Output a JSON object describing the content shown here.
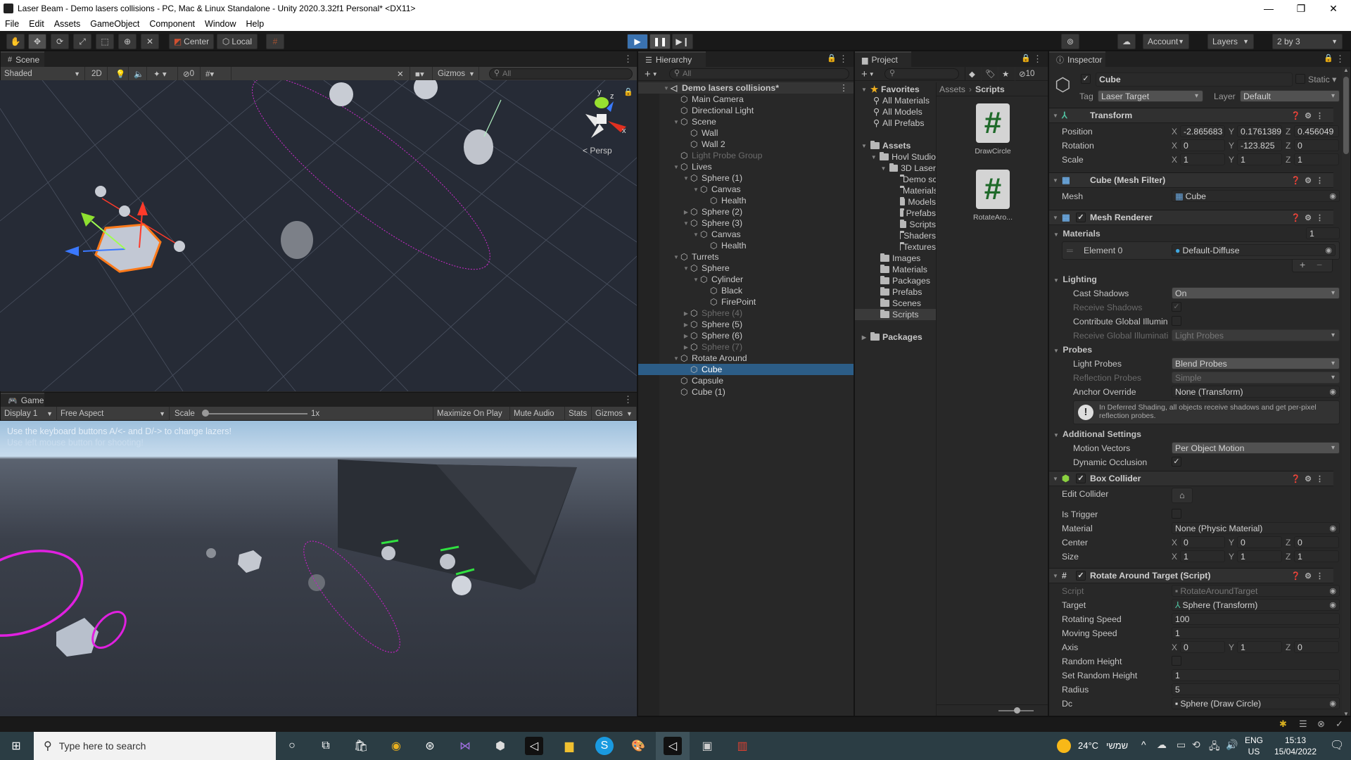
{
  "window": {
    "title": "Laser Beam - Demo lasers collisions - PC, Mac & Linux Standalone - Unity 2020.3.32f1 Personal* <DX11>",
    "controls": {
      "minimize": "—",
      "maximize": "❐",
      "close": "✕"
    }
  },
  "menu": [
    "File",
    "Edit",
    "Assets",
    "GameObject",
    "Component",
    "Window",
    "Help"
  ],
  "toolbar": {
    "tools": [
      "hand-tool",
      "move-tool",
      "rotate-tool",
      "scale-tool",
      "rect-tool",
      "transform-tool",
      "custom-tool"
    ],
    "pivot_label": "Center",
    "space_label": "Local",
    "play_state": "playing",
    "account_label": "Account",
    "layers_label": "Layers",
    "layout_label": "2 by 3"
  },
  "scene": {
    "tab_label": "Scene",
    "shading_mode": "Shaded",
    "mode_2d": "2D",
    "hidden_count": "0",
    "gizmos_label": "Gizmos",
    "search_placeholder": "All",
    "projection_label": "< Persp",
    "axis_labels": {
      "x": "x",
      "y": "y",
      "z": "z"
    }
  },
  "game": {
    "tab_label": "Game",
    "display": "Display 1",
    "aspect": "Free Aspect",
    "scale_label": "Scale",
    "scale_value": "1x",
    "maximize_on_play": "Maximize On Play",
    "mute_audio": "Mute Audio",
    "stats": "Stats",
    "gizmos": "Gizmos",
    "overlay_line1": "Use the keyboard buttons A/<- and D/-> to change lazers!",
    "overlay_line2": "Use left mouse button for shooting!"
  },
  "hierarchy": {
    "tab_label": "Hierarchy",
    "search_placeholder": "All",
    "scene_name": "Demo lasers collisions*",
    "items": [
      {
        "label": "Main Camera",
        "depth": 1,
        "arrow": "",
        "dim": false
      },
      {
        "label": "Directional Light",
        "depth": 1,
        "arrow": "",
        "dim": false
      },
      {
        "label": "Scene",
        "depth": 1,
        "arrow": "▼",
        "dim": false
      },
      {
        "label": "Wall",
        "depth": 2,
        "arrow": "",
        "dim": false
      },
      {
        "label": "Wall 2",
        "depth": 2,
        "arrow": "",
        "dim": false
      },
      {
        "label": "Light Probe Group",
        "depth": 1,
        "arrow": "",
        "dim": true
      },
      {
        "label": "Lives",
        "depth": 1,
        "arrow": "▼",
        "dim": false
      },
      {
        "label": "Sphere (1)",
        "depth": 2,
        "arrow": "▼",
        "dim": false
      },
      {
        "label": "Canvas",
        "depth": 3,
        "arrow": "▼",
        "dim": false
      },
      {
        "label": "Health",
        "depth": 4,
        "arrow": "",
        "dim": false
      },
      {
        "label": "Sphere (2)",
        "depth": 2,
        "arrow": "▶",
        "dim": false
      },
      {
        "label": "Sphere (3)",
        "depth": 2,
        "arrow": "▼",
        "dim": false
      },
      {
        "label": "Canvas",
        "depth": 3,
        "arrow": "▼",
        "dim": false
      },
      {
        "label": "Health",
        "depth": 4,
        "arrow": "",
        "dim": false
      },
      {
        "label": "Turrets",
        "depth": 1,
        "arrow": "▼",
        "dim": false
      },
      {
        "label": "Sphere",
        "depth": 2,
        "arrow": "▼",
        "dim": false
      },
      {
        "label": "Cylinder",
        "depth": 3,
        "arrow": "▼",
        "dim": false
      },
      {
        "label": "Black",
        "depth": 4,
        "arrow": "",
        "dim": false
      },
      {
        "label": "FirePoint",
        "depth": 4,
        "arrow": "",
        "dim": false
      },
      {
        "label": "Sphere (4)",
        "depth": 2,
        "arrow": "▶",
        "dim": true
      },
      {
        "label": "Sphere (5)",
        "depth": 2,
        "arrow": "▶",
        "dim": false
      },
      {
        "label": "Sphere (6)",
        "depth": 2,
        "arrow": "▶",
        "dim": false
      },
      {
        "label": "Sphere (7)",
        "depth": 2,
        "arrow": "▶",
        "dim": true
      },
      {
        "label": "Rotate Around",
        "depth": 1,
        "arrow": "▼",
        "dim": false
      },
      {
        "label": "Cube",
        "depth": 2,
        "arrow": "",
        "dim": false,
        "selected": true
      },
      {
        "label": "Capsule",
        "depth": 1,
        "arrow": "",
        "dim": false
      },
      {
        "label": "Cube (1)",
        "depth": 1,
        "arrow": "",
        "dim": false
      }
    ]
  },
  "project": {
    "tab_label": "Project",
    "hidden_packages_count": "10",
    "breadcrumb": [
      "Assets",
      "Scripts"
    ],
    "favorites_label": "Favorites",
    "favorites": [
      "All Materials",
      "All Models",
      "All Prefabs"
    ],
    "assets_label": "Assets",
    "tree": [
      {
        "label": "Hovl Studio",
        "depth": 1,
        "open": true
      },
      {
        "label": "3D Laser",
        "depth": 2,
        "open": true
      },
      {
        "label": "Demo scenes",
        "depth": 3
      },
      {
        "label": "Materials",
        "depth": 3
      },
      {
        "label": "Models",
        "depth": 3
      },
      {
        "label": "Prefabs",
        "depth": 3
      },
      {
        "label": "Scripts",
        "depth": 3
      },
      {
        "label": "Shaders",
        "depth": 3
      },
      {
        "label": "Textures",
        "depth": 3
      },
      {
        "label": "Images",
        "depth": 1
      },
      {
        "label": "Materials",
        "depth": 1
      },
      {
        "label": "Packages",
        "depth": 1
      },
      {
        "label": "Prefabs",
        "depth": 1
      },
      {
        "label": "Scenes",
        "depth": 1
      },
      {
        "label": "Scripts",
        "depth": 1,
        "selected": true
      }
    ],
    "packages_label": "Packages",
    "files": [
      {
        "name": "DrawCircle",
        "icon": "csharp-script-icon"
      },
      {
        "name": "RotateAro...",
        "icon": "csharp-script-icon"
      }
    ]
  },
  "inspector": {
    "tab_label": "Inspector",
    "object_name": "Cube",
    "active": true,
    "static_label": "Static",
    "tag_label": "Tag",
    "tag_value": "Laser Target",
    "layer_label": "Layer",
    "layer_value": "Default",
    "transform": {
      "title": "Transform",
      "position_label": "Position",
      "position": {
        "x": "-2.865683",
        "y": "0.1761389",
        "z": "0.456049"
      },
      "rotation_label": "Rotation",
      "rotation": {
        "x": "0",
        "y": "-123.825",
        "z": "0"
      },
      "scale_label": "Scale",
      "scale": {
        "x": "1",
        "y": "1",
        "z": "1"
      }
    },
    "mesh_filter": {
      "title": "Cube (Mesh Filter)",
      "mesh_label": "Mesh",
      "mesh_value": "Cube"
    },
    "mesh_renderer": {
      "title": "Mesh Renderer",
      "materials_label": "Materials",
      "materials_count": "1",
      "element0_label": "Element 0",
      "element0_value": "Default-Diffuse",
      "lighting_label": "Lighting",
      "cast_shadows_label": "Cast Shadows",
      "cast_shadows_value": "On",
      "receive_shadows_label": "Receive Shadows",
      "contribute_gi_label": "Contribute Global Illumin",
      "receive_gi_label": "Receive Global Illuminati",
      "receive_gi_value": "Light Probes",
      "probes_label": "Probes",
      "light_probes_label": "Light Probes",
      "light_probes_value": "Blend Probes",
      "reflection_probes_label": "Reflection Probes",
      "reflection_probes_value": "Simple",
      "anchor_override_label": "Anchor Override",
      "anchor_override_value": "None (Transform)",
      "info_message": "In Deferred Shading, all objects receive shadows and get per-pixel reflection probes.",
      "additional_settings_label": "Additional Settings",
      "motion_vectors_label": "Motion Vectors",
      "motion_vectors_value": "Per Object Motion",
      "dynamic_occlusion_label": "Dynamic Occlusion"
    },
    "box_collider": {
      "title": "Box Collider",
      "edit_collider_label": "Edit Collider",
      "is_trigger_label": "Is Trigger",
      "material_label": "Material",
      "material_value": "None (Physic Material)",
      "center_label": "Center",
      "center": {
        "x": "0",
        "y": "0",
        "z": "0"
      },
      "size_label": "Size",
      "size": {
        "x": "1",
        "y": "1",
        "z": "1"
      }
    },
    "rotate_script": {
      "title": "Rotate Around Target (Script)",
      "script_label": "Script",
      "script_value": "RotateAroundTarget",
      "target_label": "Target",
      "target_value": "Sphere (Transform)",
      "rotating_speed_label": "Rotating Speed",
      "rotating_speed_value": "100",
      "moving_speed_label": "Moving Speed",
      "moving_speed_value": "1",
      "axis_label": "Axis",
      "axis": {
        "x": "0",
        "y": "1",
        "z": "0"
      },
      "random_height_label": "Random Height",
      "set_random_height_label": "Set Random Height",
      "set_random_height_value": "1",
      "radius_label": "Radius",
      "radius_value": "5",
      "dc_label": "Dc",
      "dc_value": "Sphere (Draw Circle)"
    }
  },
  "taskbar": {
    "search_placeholder": "Type here to search",
    "weather_temp": "24°C",
    "weather_text": "שמשי",
    "lang_top": "ENG",
    "lang_bottom": "US",
    "time": "15:13",
    "date": "15/04/2022"
  },
  "colors": {
    "accent": "#3a72b0",
    "selection": "#2c5d87",
    "laser": "#e020e0"
  }
}
